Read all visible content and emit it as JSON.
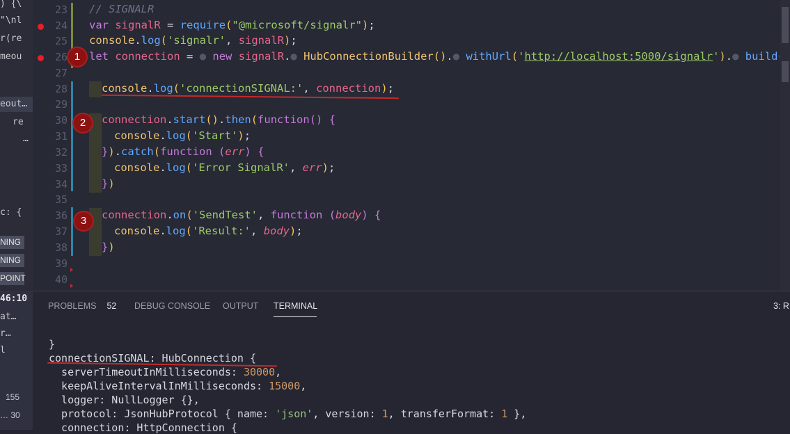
{
  "left_strip": {
    "snippets": [
      ") {\\",
      "\"\\nl",
      "r(re",
      "meou",
      "eout…",
      "re",
      "…",
      "c: {",
      "46:10",
      "at…",
      "r…",
      "l",
      "155",
      "… 30"
    ],
    "badges": [
      "NING",
      "NING",
      "POINT"
    ]
  },
  "editor": {
    "lines": [
      {
        "num": "23"
      },
      {
        "num": "24"
      },
      {
        "num": "25"
      },
      {
        "num": "26"
      },
      {
        "num": "27"
      },
      {
        "num": "28"
      },
      {
        "num": "29"
      },
      {
        "num": "30"
      },
      {
        "num": "31"
      },
      {
        "num": "32"
      },
      {
        "num": "33"
      },
      {
        "num": "34"
      },
      {
        "num": "35"
      },
      {
        "num": "36"
      },
      {
        "num": "37"
      },
      {
        "num": "38"
      },
      {
        "num": "39"
      },
      {
        "num": "40"
      }
    ],
    "markers": [
      "1",
      "2",
      "3"
    ],
    "breakpoint_color": "#e51f2b"
  },
  "panel": {
    "tabs": [
      {
        "label": "PROBLEMS",
        "count": "52"
      },
      {
        "label": "DEBUG CONSOLE"
      },
      {
        "label": "OUTPUT"
      },
      {
        "label": "TERMINAL",
        "active": true
      }
    ],
    "right_label": "3: R"
  },
  "colors": {
    "background": "#272935",
    "keyword": "#c67bdb",
    "variable": "#e8668a",
    "function": "#61a8ff",
    "string": "#9ccc65",
    "annotation_red": "#8c1212"
  }
}
